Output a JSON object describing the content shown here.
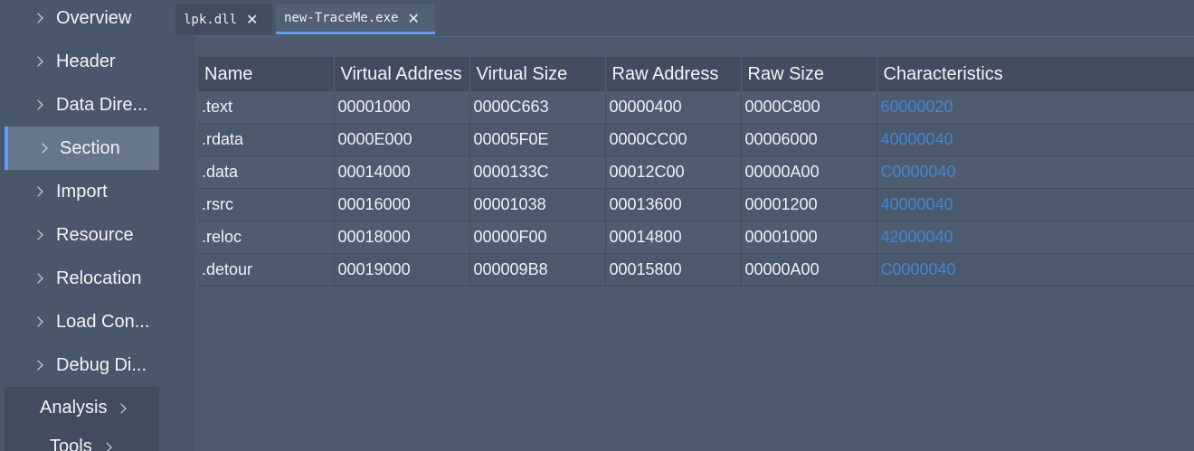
{
  "sidebar": {
    "items": [
      {
        "label": "Overview"
      },
      {
        "label": "Header"
      },
      {
        "label": "Data Dire..."
      },
      {
        "label": "Section"
      },
      {
        "label": "Import"
      },
      {
        "label": "Resource"
      },
      {
        "label": "Relocation"
      },
      {
        "label": "Load Con..."
      },
      {
        "label": "Debug Di..."
      }
    ],
    "active_index": 3,
    "groups": [
      {
        "label": "Analysis"
      },
      {
        "label": "Tools"
      }
    ]
  },
  "tabs": [
    {
      "label": "lpk.dll",
      "active": false
    },
    {
      "label": "new-TraceMe.exe",
      "active": true
    }
  ],
  "table": {
    "columns": [
      "Name",
      "Virtual Address",
      "Virtual Size",
      "Raw Address",
      "Raw Size",
      "Characteristics"
    ],
    "rows": [
      [
        ".text",
        "00001000",
        "0000C663",
        "00000400",
        "0000C800",
        "60000020"
      ],
      [
        ".rdata",
        "0000E000",
        "00005F0E",
        "0000CC00",
        "00006000",
        "40000040"
      ],
      [
        ".data",
        "00014000",
        "0000133C",
        "00012C00",
        "00000A00",
        "C0000040"
      ],
      [
        ".rsrc",
        "00016000",
        "00001038",
        "00013600",
        "00001200",
        "40000040"
      ],
      [
        ".reloc",
        "00018000",
        "00000F00",
        "00014800",
        "00001000",
        "42000040"
      ],
      [
        ".detour",
        "00019000",
        "000009B8",
        "00015800",
        "00000A00",
        "C0000040"
      ]
    ]
  },
  "colors": {
    "accent": "#5e9df5",
    "link": "#3f86d2",
    "background": "#4a5669"
  }
}
